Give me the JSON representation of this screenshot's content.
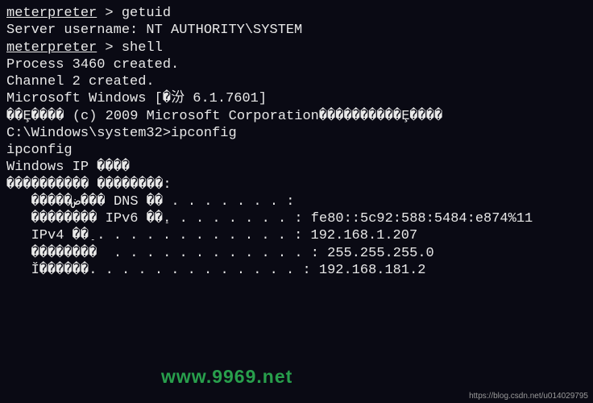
{
  "lines": {
    "l0_prompt": "meterpreter",
    "l0_sep": " > ",
    "l0_cmd": "getuid",
    "l1": "Server username: NT AUTHORITY\\SYSTEM",
    "l2_prompt": "meterpreter",
    "l2_sep": " > ",
    "l2_cmd": "shell",
    "l3": "Process 3460 created.",
    "l4": "Channel 2 created.",
    "l5": "Microsoft Windows [�汾 6.1.7601]",
    "l6": "��Ȩ���� (c) 2009 Microsoft Corporation����������Ȩ����",
    "l7": "",
    "l8": "C:\\Windows\\system32>ipconfig",
    "l9": "ipconfig",
    "l10": "",
    "l11": "Windows IP ����",
    "l12": "",
    "l13": "",
    "l14": "���������� ��������:",
    "l15": "",
    "l16": "   �����ض��� DNS ��׺ . . . . . . . :",
    "l17": "   �������� IPv6 ��ַ. . . . . . . . : fe80::5c92:588:5484:e874%11",
    "l18": "   IPv4 ��ַ . . . . . . . . . . . . : 192.168.1.207",
    "l19": "   ��������  . . . . . . . . . . . . : 255.255.255.0",
    "l20": "   Ĭ������. . . . . . . . . . . . . : 192.168.181.2"
  },
  "watermarks": {
    "green": "www.9969.net",
    "csdn": "https://blog.csdn.net/u014029795"
  }
}
